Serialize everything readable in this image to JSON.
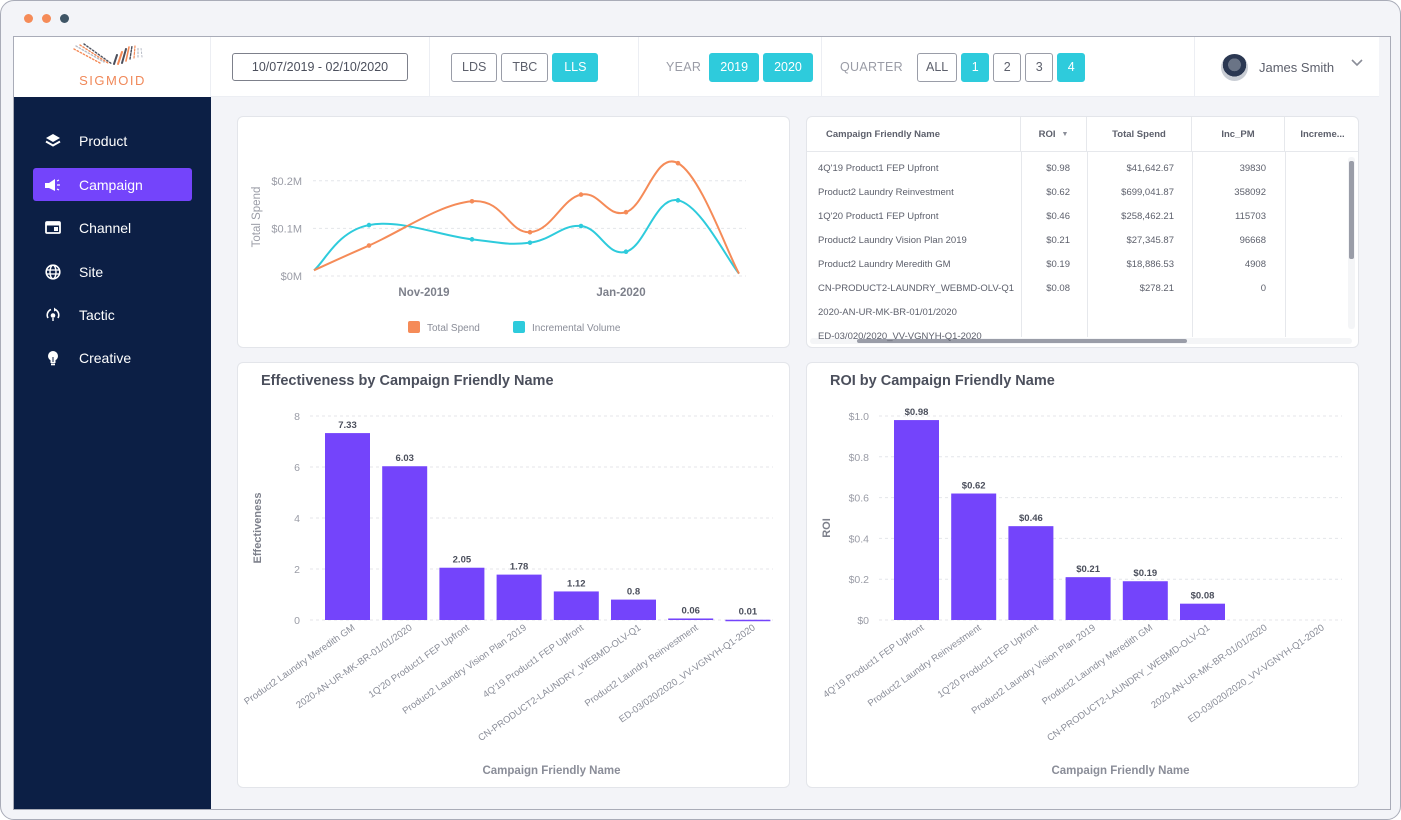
{
  "window": {
    "dot_colors": [
      "#f58b58",
      "#f58b58",
      "#3f5566"
    ]
  },
  "brand": {
    "name": "SIGMOID",
    "accent": "#7444fb",
    "teal": "#2ecbdc",
    "orange": "#f58b58",
    "sidebar_bg": "#0c1f45"
  },
  "header": {
    "date_range": "10/07/2019 - 02/10/2020",
    "segment_buttons": [
      {
        "label": "LDS",
        "active": false
      },
      {
        "label": "TBC",
        "active": false
      },
      {
        "label": "LLS",
        "active": true
      }
    ],
    "year_label": "YEAR",
    "year_buttons": [
      {
        "label": "2019",
        "active": true
      },
      {
        "label": "2020",
        "active": true
      }
    ],
    "quarter_label": "QUARTER",
    "quarter_buttons": [
      {
        "label": "ALL",
        "active": false
      },
      {
        "label": "1",
        "active": true
      },
      {
        "label": "2",
        "active": false
      },
      {
        "label": "3",
        "active": false
      },
      {
        "label": "4",
        "active": true
      }
    ],
    "user_name": "James Smith"
  },
  "sidebar": {
    "items": [
      {
        "label": "Product",
        "icon": "layers-icon",
        "active": false
      },
      {
        "label": "Campaign",
        "icon": "megaphone-icon",
        "active": true
      },
      {
        "label": "Channel",
        "icon": "browser-window-icon",
        "active": false
      },
      {
        "label": "Site",
        "icon": "globe-icon",
        "active": false
      },
      {
        "label": "Tactic",
        "icon": "rotate-target-icon",
        "active": false
      },
      {
        "label": "Creative",
        "icon": "lightbulb-icon",
        "active": false
      }
    ]
  },
  "table": {
    "columns": [
      "Campaign Friendly Name",
      "ROI",
      "Total Spend",
      "Inc_PM",
      "Increme..."
    ],
    "sort_column": "ROI",
    "rows": [
      [
        "4Q'19 Product1 FEP Upfront",
        "$0.98",
        "$41,642.67",
        "39830",
        ""
      ],
      [
        "Product2 Laundry Reinvestment",
        "$0.62",
        "$699,041.87",
        "358092",
        ""
      ],
      [
        "1Q'20 Product1 FEP Upfront",
        "$0.46",
        "$258,462.21",
        "115703",
        ""
      ],
      [
        "Product2 Laundry Vision Plan 2019",
        "$0.21",
        "$27,345.87",
        "96668",
        ""
      ],
      [
        "Product2 Laundry Meredith GM",
        "$0.19",
        "$18,886.53",
        "4908",
        ""
      ],
      [
        "CN-PRODUCT2-LAUNDRY_WEBMD-OLV-Q1",
        "$0.08",
        "$278.21",
        "0",
        ""
      ],
      [
        "2020-AN-UR-MK-BR-01/01/2020",
        "",
        "",
        "",
        ""
      ],
      [
        "ED-03/020/2020_VV-VGNYH-Q1-2020",
        "",
        "",
        "",
        ""
      ]
    ]
  },
  "chart_data": [
    {
      "type": "line",
      "title": "",
      "xlabel": "",
      "ylabel": "Total Spend",
      "x_tick_labels": [
        "Nov-2019",
        "Jan-2020"
      ],
      "y_tick_labels": [
        "$0M",
        "$0.1M",
        "$0.2M"
      ],
      "ylim": [
        0,
        0.25
      ],
      "y_ticks": [
        0,
        0.1,
        0.2
      ],
      "grid": true,
      "legend_position": "bottom",
      "smooth": true,
      "x": [
        0,
        1,
        2,
        3,
        4,
        5,
        6,
        7
      ],
      "x_tick_positions": [
        1.9,
        5.6
      ],
      "series": [
        {
          "name": "Total Spend",
          "color": "#f58b58",
          "values": [
            0.012,
            0.064,
            0.157,
            0.092,
            0.171,
            0.134,
            0.237,
            0.005
          ]
        },
        {
          "name": "Incremental Volume",
          "color": "#2ecbdc",
          "values": [
            0.012,
            0.107,
            0.077,
            0.07,
            0.105,
            0.051,
            0.159,
            0.005
          ]
        }
      ]
    },
    {
      "type": "bar",
      "title": "Effectiveness by Campaign Friendly Name",
      "xlabel": "Campaign Friendly Name",
      "ylabel": "Effectiveness",
      "categories": [
        "Product2 Laundry Meredith GM",
        "2020-AN-UR-MK-BR-01/01/2020",
        "1Q'20 Product1 FEP Upfront",
        "Product2 Laundry Vision Plan 2019",
        "4Q'19 Product1 FEP Upfront",
        "CN-PRODUCT2-LAUNDRY_WEBMD-OLV-Q1",
        "Product2 Laundry Reinvestment",
        "ED-03/020/2020_VV-VGNYH-Q1-2020"
      ],
      "values": [
        7.33,
        6.03,
        2.05,
        1.78,
        1.12,
        0.8,
        0.06,
        0.01
      ],
      "value_labels": [
        "7.33",
        "6.03",
        "2.05",
        "1.78",
        "1.12",
        "0.8",
        "0.06",
        "0.01"
      ],
      "y_tick_labels": [
        "0",
        "2",
        "4",
        "6",
        "8"
      ],
      "y_ticks": [
        0,
        2,
        4,
        6,
        8
      ],
      "ylim": [
        0,
        8
      ],
      "grid": true,
      "color": "#7444fb"
    },
    {
      "type": "bar",
      "title": "ROI by Campaign Friendly Name",
      "xlabel": "Campaign Friendly Name",
      "ylabel": "ROI",
      "categories": [
        "4Q'19 Product1 FEP Upfront",
        "Product2 Laundry Reinvestment",
        "1Q'20 Product1 FEP Upfront",
        "Product2 Laundry Vision Plan 2019",
        "Product2 Laundry Meredith GM",
        "CN-PRODUCT2-LAUNDRY_WEBMD-OLV-Q1",
        "2020-AN-UR-MK-BR-01/01/2020",
        "ED-03/020/2020_VV-VGNYH-Q1-2020"
      ],
      "values": [
        0.98,
        0.62,
        0.46,
        0.21,
        0.19,
        0.08,
        null,
        null
      ],
      "value_labels": [
        "$0.98",
        "$0.62",
        "$0.46",
        "$0.21",
        "$0.19",
        "$0.08",
        "",
        ""
      ],
      "y_tick_labels": [
        "$0",
        "$0.2",
        "$0.4",
        "$0.6",
        "$0.8",
        "$1.0"
      ],
      "y_ticks": [
        0,
        0.2,
        0.4,
        0.6,
        0.8,
        1.0
      ],
      "ylim": [
        0,
        1.0
      ],
      "grid": true,
      "color": "#7444fb"
    }
  ]
}
